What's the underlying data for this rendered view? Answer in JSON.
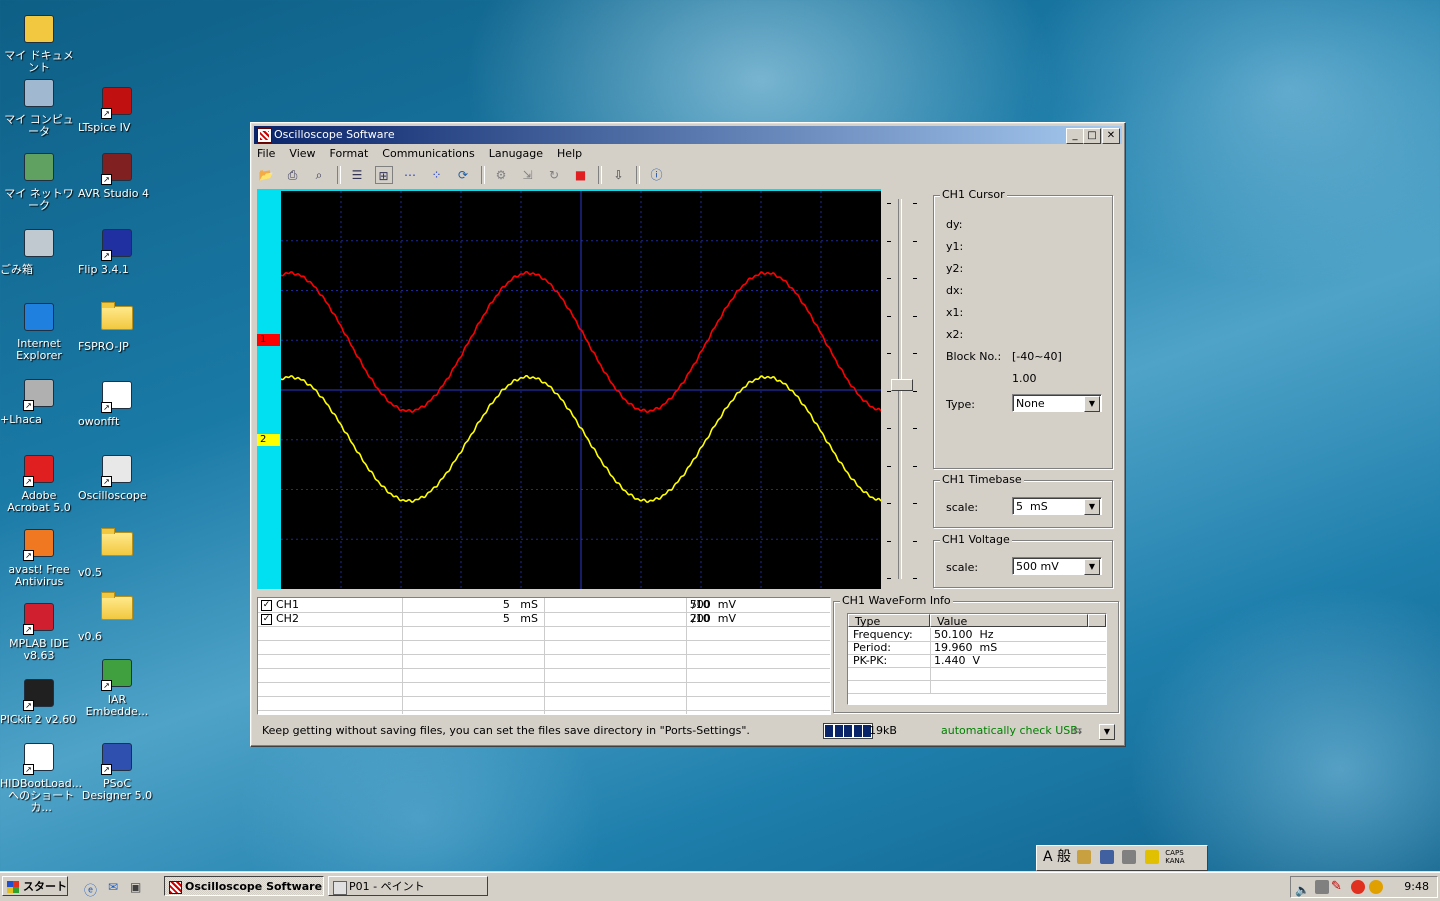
{
  "desktop": {
    "icons_left": [
      {
        "label": "マイ ドキュメント",
        "icon": "my-documents-icon"
      },
      {
        "label": "マイ コンピュータ",
        "icon": "my-computer-icon"
      },
      {
        "label": "マイ ネットワーク",
        "icon": "my-network-icon"
      },
      {
        "label": "ごみ箱",
        "icon": "recycle-bin-icon"
      },
      {
        "label": "Internet Explorer",
        "icon": "internet-explorer-icon"
      },
      {
        "label": "+Lhaca",
        "icon": "lhaca-icon"
      },
      {
        "label": "Adobe Acrobat 5.0",
        "icon": "adobe-acrobat-icon"
      },
      {
        "label": "avast! Free Antivirus",
        "icon": "avast-icon"
      },
      {
        "label": "MPLAB IDE v8.63",
        "icon": "mplab-icon"
      },
      {
        "label": "PICkit 2 v2.60",
        "icon": "pickit-icon"
      },
      {
        "label": "HIDBootLoad... へのショートカ...",
        "icon": "hidbootloader-icon"
      }
    ],
    "icons_right": [
      {
        "label": "LTspice IV",
        "icon": "ltspice-icon"
      },
      {
        "label": "AVR Studio 4",
        "icon": "avr-studio-icon"
      },
      {
        "label": "Flip 3.4.1",
        "icon": "flip-icon"
      },
      {
        "label": "FSPRO-JP",
        "icon": "folder-icon"
      },
      {
        "label": "owonfft",
        "icon": "window-app-icon"
      },
      {
        "label": "Oscilloscope",
        "icon": "oscilloscope-icon"
      },
      {
        "label": "v0.5",
        "icon": "folder-icon"
      },
      {
        "label": "v0.6",
        "icon": "folder-icon"
      },
      {
        "label": "IAR Embedde...",
        "icon": "iar-icon"
      },
      {
        "label": "PSoC Designer 5.0",
        "icon": "psoc-icon"
      }
    ]
  },
  "window": {
    "title": "Oscilloscope Software",
    "menu": [
      "File",
      "View",
      "Format",
      "Communications",
      "Lanugage",
      "Help"
    ],
    "channel_markers": [
      "1",
      "2"
    ],
    "colors": {
      "ch1": "#ff0000",
      "ch2": "#ffff00",
      "grid": "#1a2a9a"
    },
    "cursor": {
      "title": "CH1 Cursor",
      "dy": "dy:",
      "y1": "y1:",
      "y2": "y2:",
      "dx": "dx:",
      "x1": "x1:",
      "x2": "x2:",
      "block_label": "Block No.:",
      "block_range": "[-40~40]",
      "block_value": "1.00",
      "type_label": "Type:",
      "type_value": "None"
    },
    "timebase": {
      "title": "CH1 Timebase",
      "label": "scale:",
      "value": "5  mS"
    },
    "voltage": {
      "title": "CH1 Voltage",
      "label": "scale:",
      "value": "500 mV"
    },
    "channels": [
      {
        "name": "CH1",
        "time": "5   mS",
        "volt": "500  mV",
        "probe": "/10"
      },
      {
        "name": "CH2",
        "time": "5   mS",
        "volt": "200  mV",
        "probe": "/10"
      }
    ],
    "waveinfo": {
      "title": "CH1 WaveForm Info",
      "col_type": "Type",
      "col_value": "Value",
      "rows": [
        {
          "type": "Frequency:",
          "value": "50.100  Hz"
        },
        {
          "type": "Period:",
          "value": "19.960  mS"
        },
        {
          "type": "PK-PK:",
          "value": "1.440  V"
        }
      ]
    },
    "status": {
      "message": "Keep getting without saving files, you can set the files save directory in \"Ports-Settings\".",
      "size": "19kB",
      "usb": "automatically check USB:",
      "progress_fraction": 1.0
    }
  },
  "taskbar": {
    "start": "スタート",
    "tasks": [
      "Oscilloscope Software",
      "P01 - ペイント"
    ],
    "clock": "9:48",
    "ime": "A 般"
  }
}
